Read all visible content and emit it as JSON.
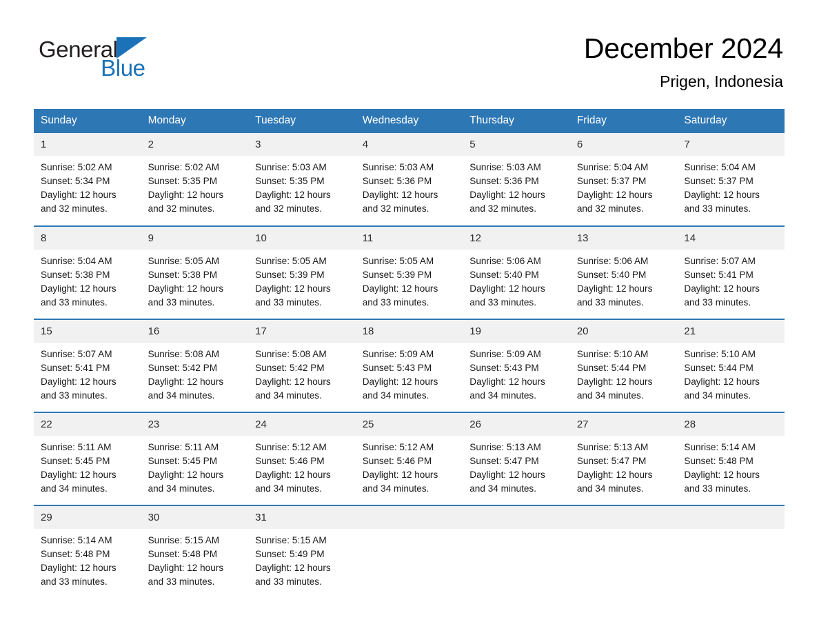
{
  "brand": {
    "name_part1": "General",
    "name_part2": "Blue",
    "accent_color": "#1b72b8"
  },
  "header": {
    "month_title": "December 2024",
    "location": "Prigen, Indonesia"
  },
  "colors": {
    "header_blue": "#2e77b5",
    "daynum_band": "#f1f1f1",
    "text": "#000000"
  },
  "calendar": {
    "weekday_headers": [
      "Sunday",
      "Monday",
      "Tuesday",
      "Wednesday",
      "Thursday",
      "Friday",
      "Saturday"
    ],
    "weeks": [
      [
        {
          "day": "1",
          "sunrise": "Sunrise: 5:02 AM",
          "sunset": "Sunset: 5:34 PM",
          "daylight_line1": "Daylight: 12 hours",
          "daylight_line2": "and 32 minutes."
        },
        {
          "day": "2",
          "sunrise": "Sunrise: 5:02 AM",
          "sunset": "Sunset: 5:35 PM",
          "daylight_line1": "Daylight: 12 hours",
          "daylight_line2": "and 32 minutes."
        },
        {
          "day": "3",
          "sunrise": "Sunrise: 5:03 AM",
          "sunset": "Sunset: 5:35 PM",
          "daylight_line1": "Daylight: 12 hours",
          "daylight_line2": "and 32 minutes."
        },
        {
          "day": "4",
          "sunrise": "Sunrise: 5:03 AM",
          "sunset": "Sunset: 5:36 PM",
          "daylight_line1": "Daylight: 12 hours",
          "daylight_line2": "and 32 minutes."
        },
        {
          "day": "5",
          "sunrise": "Sunrise: 5:03 AM",
          "sunset": "Sunset: 5:36 PM",
          "daylight_line1": "Daylight: 12 hours",
          "daylight_line2": "and 32 minutes."
        },
        {
          "day": "6",
          "sunrise": "Sunrise: 5:04 AM",
          "sunset": "Sunset: 5:37 PM",
          "daylight_line1": "Daylight: 12 hours",
          "daylight_line2": "and 32 minutes."
        },
        {
          "day": "7",
          "sunrise": "Sunrise: 5:04 AM",
          "sunset": "Sunset: 5:37 PM",
          "daylight_line1": "Daylight: 12 hours",
          "daylight_line2": "and 33 minutes."
        }
      ],
      [
        {
          "day": "8",
          "sunrise": "Sunrise: 5:04 AM",
          "sunset": "Sunset: 5:38 PM",
          "daylight_line1": "Daylight: 12 hours",
          "daylight_line2": "and 33 minutes."
        },
        {
          "day": "9",
          "sunrise": "Sunrise: 5:05 AM",
          "sunset": "Sunset: 5:38 PM",
          "daylight_line1": "Daylight: 12 hours",
          "daylight_line2": "and 33 minutes."
        },
        {
          "day": "10",
          "sunrise": "Sunrise: 5:05 AM",
          "sunset": "Sunset: 5:39 PM",
          "daylight_line1": "Daylight: 12 hours",
          "daylight_line2": "and 33 minutes."
        },
        {
          "day": "11",
          "sunrise": "Sunrise: 5:05 AM",
          "sunset": "Sunset: 5:39 PM",
          "daylight_line1": "Daylight: 12 hours",
          "daylight_line2": "and 33 minutes."
        },
        {
          "day": "12",
          "sunrise": "Sunrise: 5:06 AM",
          "sunset": "Sunset: 5:40 PM",
          "daylight_line1": "Daylight: 12 hours",
          "daylight_line2": "and 33 minutes."
        },
        {
          "day": "13",
          "sunrise": "Sunrise: 5:06 AM",
          "sunset": "Sunset: 5:40 PM",
          "daylight_line1": "Daylight: 12 hours",
          "daylight_line2": "and 33 minutes."
        },
        {
          "day": "14",
          "sunrise": "Sunrise: 5:07 AM",
          "sunset": "Sunset: 5:41 PM",
          "daylight_line1": "Daylight: 12 hours",
          "daylight_line2": "and 33 minutes."
        }
      ],
      [
        {
          "day": "15",
          "sunrise": "Sunrise: 5:07 AM",
          "sunset": "Sunset: 5:41 PM",
          "daylight_line1": "Daylight: 12 hours",
          "daylight_line2": "and 33 minutes."
        },
        {
          "day": "16",
          "sunrise": "Sunrise: 5:08 AM",
          "sunset": "Sunset: 5:42 PM",
          "daylight_line1": "Daylight: 12 hours",
          "daylight_line2": "and 34 minutes."
        },
        {
          "day": "17",
          "sunrise": "Sunrise: 5:08 AM",
          "sunset": "Sunset: 5:42 PM",
          "daylight_line1": "Daylight: 12 hours",
          "daylight_line2": "and 34 minutes."
        },
        {
          "day": "18",
          "sunrise": "Sunrise: 5:09 AM",
          "sunset": "Sunset: 5:43 PM",
          "daylight_line1": "Daylight: 12 hours",
          "daylight_line2": "and 34 minutes."
        },
        {
          "day": "19",
          "sunrise": "Sunrise: 5:09 AM",
          "sunset": "Sunset: 5:43 PM",
          "daylight_line1": "Daylight: 12 hours",
          "daylight_line2": "and 34 minutes."
        },
        {
          "day": "20",
          "sunrise": "Sunrise: 5:10 AM",
          "sunset": "Sunset: 5:44 PM",
          "daylight_line1": "Daylight: 12 hours",
          "daylight_line2": "and 34 minutes."
        },
        {
          "day": "21",
          "sunrise": "Sunrise: 5:10 AM",
          "sunset": "Sunset: 5:44 PM",
          "daylight_line1": "Daylight: 12 hours",
          "daylight_line2": "and 34 minutes."
        }
      ],
      [
        {
          "day": "22",
          "sunrise": "Sunrise: 5:11 AM",
          "sunset": "Sunset: 5:45 PM",
          "daylight_line1": "Daylight: 12 hours",
          "daylight_line2": "and 34 minutes."
        },
        {
          "day": "23",
          "sunrise": "Sunrise: 5:11 AM",
          "sunset": "Sunset: 5:45 PM",
          "daylight_line1": "Daylight: 12 hours",
          "daylight_line2": "and 34 minutes."
        },
        {
          "day": "24",
          "sunrise": "Sunrise: 5:12 AM",
          "sunset": "Sunset: 5:46 PM",
          "daylight_line1": "Daylight: 12 hours",
          "daylight_line2": "and 34 minutes."
        },
        {
          "day": "25",
          "sunrise": "Sunrise: 5:12 AM",
          "sunset": "Sunset: 5:46 PM",
          "daylight_line1": "Daylight: 12 hours",
          "daylight_line2": "and 34 minutes."
        },
        {
          "day": "26",
          "sunrise": "Sunrise: 5:13 AM",
          "sunset": "Sunset: 5:47 PM",
          "daylight_line1": "Daylight: 12 hours",
          "daylight_line2": "and 34 minutes."
        },
        {
          "day": "27",
          "sunrise": "Sunrise: 5:13 AM",
          "sunset": "Sunset: 5:47 PM",
          "daylight_line1": "Daylight: 12 hours",
          "daylight_line2": "and 34 minutes."
        },
        {
          "day": "28",
          "sunrise": "Sunrise: 5:14 AM",
          "sunset": "Sunset: 5:48 PM",
          "daylight_line1": "Daylight: 12 hours",
          "daylight_line2": "and 33 minutes."
        }
      ],
      [
        {
          "day": "29",
          "sunrise": "Sunrise: 5:14 AM",
          "sunset": "Sunset: 5:48 PM",
          "daylight_line1": "Daylight: 12 hours",
          "daylight_line2": "and 33 minutes."
        },
        {
          "day": "30",
          "sunrise": "Sunrise: 5:15 AM",
          "sunset": "Sunset: 5:48 PM",
          "daylight_line1": "Daylight: 12 hours",
          "daylight_line2": "and 33 minutes."
        },
        {
          "day": "31",
          "sunrise": "Sunrise: 5:15 AM",
          "sunset": "Sunset: 5:49 PM",
          "daylight_line1": "Daylight: 12 hours",
          "daylight_line2": "and 33 minutes."
        },
        {
          "day": "",
          "sunrise": "",
          "sunset": "",
          "daylight_line1": "",
          "daylight_line2": ""
        },
        {
          "day": "",
          "sunrise": "",
          "sunset": "",
          "daylight_line1": "",
          "daylight_line2": ""
        },
        {
          "day": "",
          "sunrise": "",
          "sunset": "",
          "daylight_line1": "",
          "daylight_line2": ""
        },
        {
          "day": "",
          "sunrise": "",
          "sunset": "",
          "daylight_line1": "",
          "daylight_line2": ""
        }
      ]
    ]
  }
}
